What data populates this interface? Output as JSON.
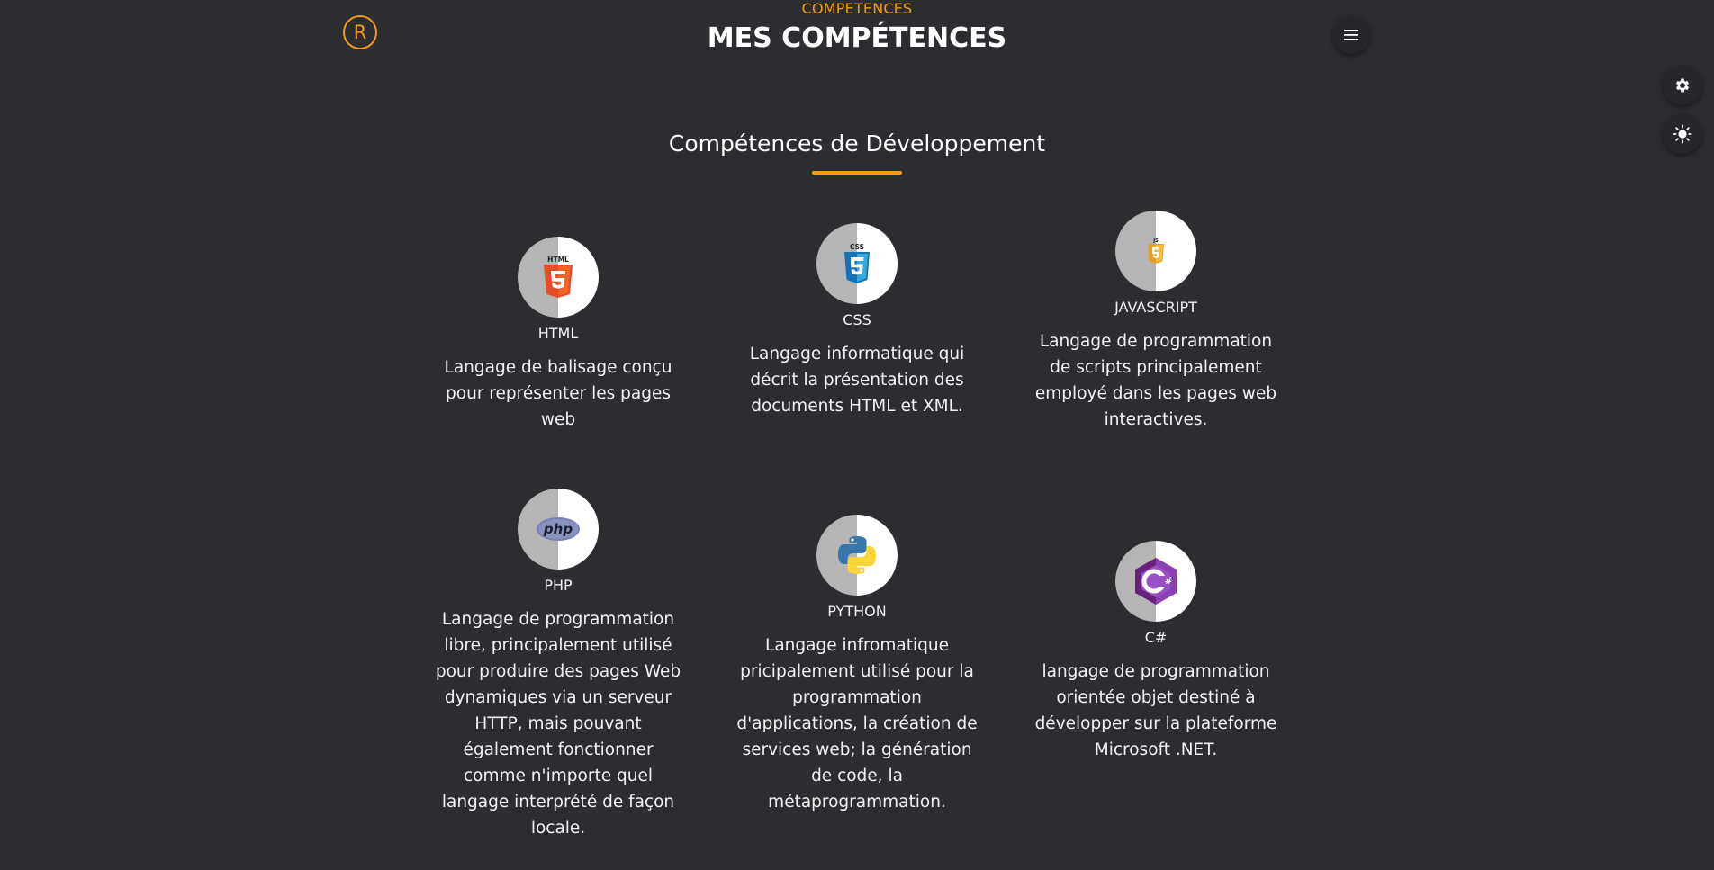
{
  "header": {
    "logo_letter": "R",
    "eyebrow": "COMPETENCES",
    "title": "MES COMPÉTENCES"
  },
  "section": {
    "title": "Compétences de Développement"
  },
  "skills": [
    {
      "name": "HTML",
      "icon": "html5-icon",
      "description": "Langage de balisage conçu pour représenter les pages web"
    },
    {
      "name": "CSS",
      "icon": "css3-icon",
      "description": "Langage informatique qui décrit la présentation des documents HTML et XML."
    },
    {
      "name": "JAVASCRIPT",
      "icon": "javascript-icon",
      "description": "Langage de programmation de scripts principalement employé dans les pages web interactives."
    },
    {
      "name": "PHP",
      "icon": "php-icon",
      "description": "Langage de programmation libre, principalement utilisé pour produire des pages Web dynamiques via un serveur HTTP, mais pouvant également fonctionner comme n'importe quel langage interprété de façon locale."
    },
    {
      "name": "PYTHON",
      "icon": "python-icon",
      "description": "Langage infromatique pricipalement utilisé pour la programmation d'applications, la création de services web; la génération de code, la métaprogrammation."
    },
    {
      "name": "C#",
      "icon": "csharp-icon",
      "description": "langage de programmation orientée objet destiné à développer sur la plateforme Microsoft .NET."
    }
  ],
  "icons": {
    "menu": "hamburger-menu-icon",
    "settings": "gear-icon",
    "theme": "sun-icon"
  },
  "colors": {
    "accent": "#f39c12",
    "background": "#2b2d31"
  }
}
